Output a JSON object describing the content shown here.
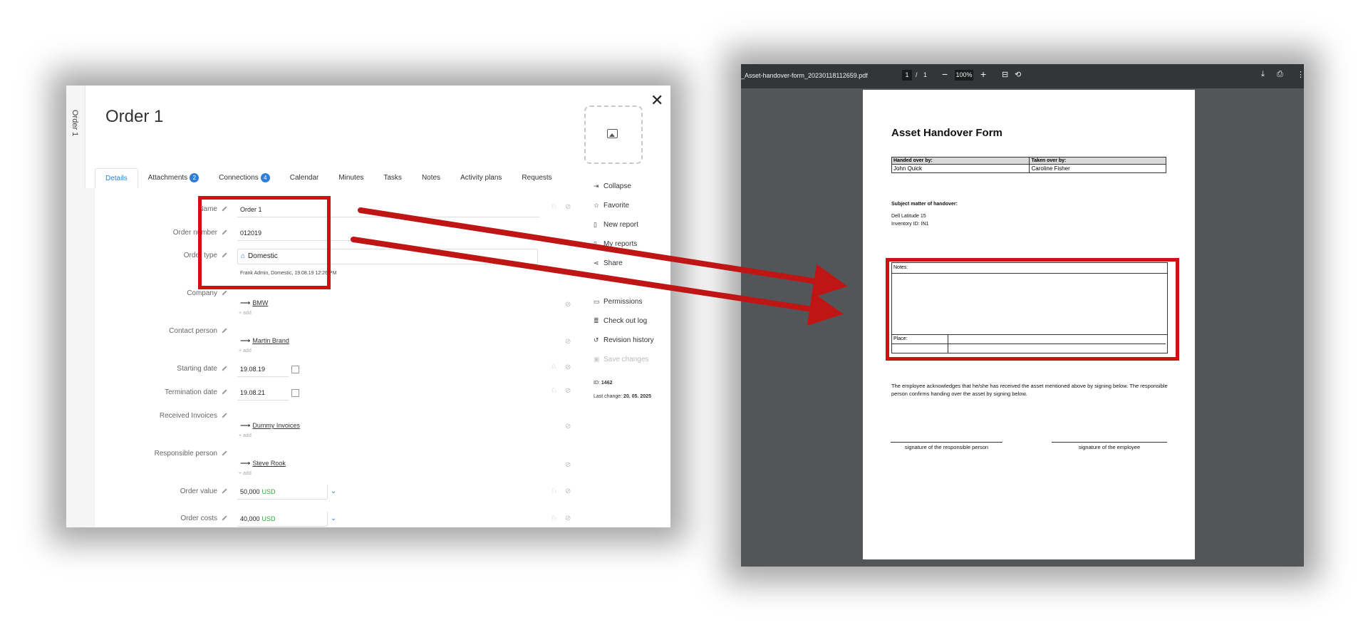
{
  "crm": {
    "vertical_tab": "Order 1",
    "title": "Order 1",
    "tabs": [
      {
        "label": "Details",
        "active": true
      },
      {
        "label": "Attachments",
        "badge": "2"
      },
      {
        "label": "Connections",
        "badge": "4"
      },
      {
        "label": "Calendar"
      },
      {
        "label": "Minutes"
      },
      {
        "label": "Tasks"
      },
      {
        "label": "Notes"
      },
      {
        "label": "Activity plans"
      },
      {
        "label": "Requests"
      }
    ],
    "fields": {
      "name_label": "Name",
      "name_value": "Order 1",
      "order_number_label": "Order number",
      "order_number_value": "012019",
      "order_type_label": "Order type",
      "order_type_value": "Domestic",
      "order_type_hint": "Frank Admin, Domestic, 19.08.19 12:26 PM",
      "company_label": "Company",
      "company_value": "BMW",
      "contact_label": "Contact person",
      "contact_value": "Martin Brand",
      "starting_label": "Starting date",
      "starting_value": "19.08.19",
      "termination_label": "Termination date",
      "termination_value": "19.08.21",
      "invoices_label": "Received Invoices",
      "invoices_value": "Dummy Invoices",
      "responsible_label": "Responsible person",
      "responsible_value": "Steve Rook",
      "order_value_label": "Order value",
      "order_value_value": "50,000",
      "order_value_currency": "USD",
      "order_costs_label": "Order costs",
      "order_costs_value": "40,000",
      "order_costs_currency": "USD",
      "add_text": "+ add"
    },
    "side_actions": [
      {
        "label": "Collapse",
        "icon": "collapse-icon"
      },
      {
        "label": "Favorite",
        "icon": "star-icon"
      },
      {
        "label": "New report",
        "icon": "report-icon"
      },
      {
        "label": "My reports",
        "icon": "reports-icon"
      },
      {
        "label": "Share",
        "icon": "share-icon"
      },
      {
        "label": "",
        "icon": ""
      },
      {
        "label": "Permissions",
        "icon": "permissions-icon"
      },
      {
        "label": "Check out log",
        "icon": "log-icon"
      },
      {
        "label": "Revision history",
        "icon": "history-icon"
      },
      {
        "label": "Save changes",
        "icon": "save-icon",
        "disabled": true
      }
    ],
    "id_label": "ID:",
    "id_value": "1462",
    "last_change_label": "Last change:",
    "last_change_value": "20. 05. 2025"
  },
  "pdf": {
    "filename": "_Asset-handover-form_20230118112659.pdf",
    "page_current": "1",
    "page_sep": "/",
    "page_total": "1",
    "zoom": "100%",
    "title": "Asset Handover Form",
    "handed_over_label": "Handed over by:",
    "handed_over_value": "John Quick",
    "taken_over_label": "Taken over by:",
    "taken_over_value": "Caroline Fisher",
    "subject_label": "Subject matter of handover:",
    "subject_line1": "Dell Latitude 15",
    "subject_line2": "Inventory ID: IN1",
    "notes_label": "Notes:",
    "place_label": "Place:",
    "ack_text": "The employee acknowledges that he/she has received the asset mentioned above by signing below. The responsible person confirms handing over the asset by signing below.",
    "sig_responsible": "signature of the responsible person",
    "sig_employee": "signature of the employee"
  },
  "colors": {
    "highlight": "#d01111",
    "accent": "#2f7fd8",
    "currency": "#2caa3a"
  }
}
